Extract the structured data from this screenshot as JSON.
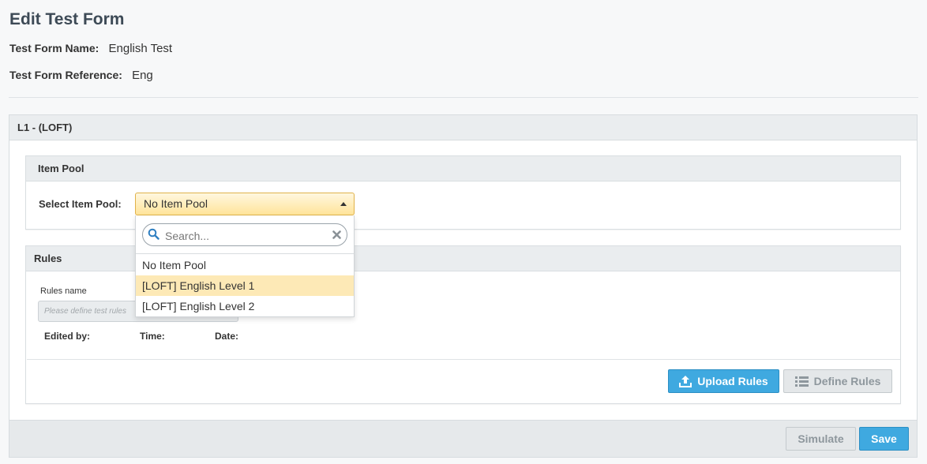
{
  "page": {
    "title": "Edit Test Form",
    "name_label": "Test Form Name:",
    "name_value": "English Test",
    "reference_label": "Test Form Reference:",
    "reference_value": "Eng"
  },
  "section": {
    "title": "L1 - (LOFT)"
  },
  "item_pool": {
    "title": "Item Pool",
    "select_label": "Select Item Pool:",
    "selected": "No Item Pool",
    "search_placeholder": "Search...",
    "options": [
      {
        "label": "No Item Pool",
        "highlighted": false
      },
      {
        "label": "[LOFT] English Level 1",
        "highlighted": true
      },
      {
        "label": "[LOFT] English Level 2",
        "highlighted": false
      }
    ]
  },
  "rules": {
    "title": "Rules",
    "name_label": "Rules name",
    "name_placeholder": "Please define test rules",
    "edited_by_label": "Edited by:",
    "time_label": "Time:",
    "date_label": "Date:",
    "upload_label": "Upload Rules",
    "define_label": "Define Rules"
  },
  "footer": {
    "simulate_label": "Simulate",
    "save_label": "Save"
  },
  "colors": {
    "primary": "#3fa9e0",
    "select_highlight": "#ffe49a",
    "option_highlight": "#fde9b6"
  },
  "icons": [
    "search-icon",
    "clear-icon",
    "caret-up-icon",
    "upload-icon",
    "list-icon"
  ]
}
